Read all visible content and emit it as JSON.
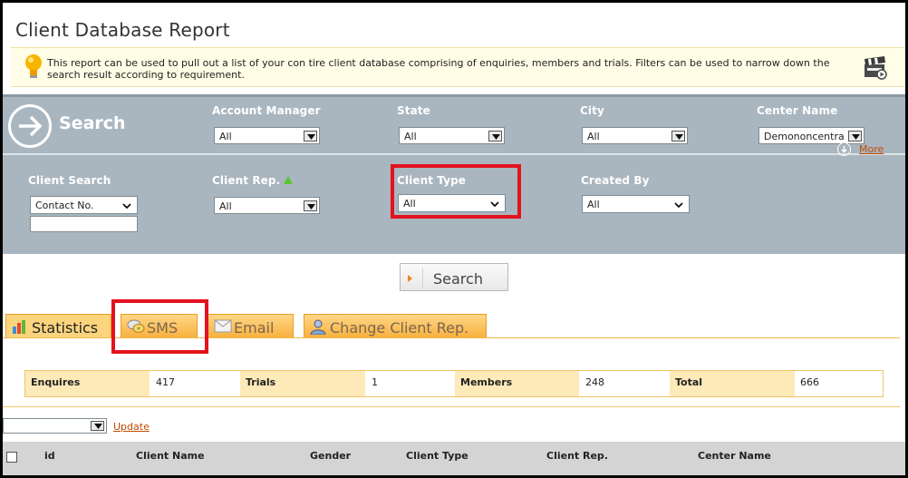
{
  "page": {
    "title": "Client Database Report",
    "info_text": "This report can be used to pull out a list of your con tire client database comprising of enquiries, members and trials. Filters can be used to narrow down the search result according to requirement."
  },
  "search_panel": {
    "heading": "Search",
    "filters": {
      "account_manager": {
        "label": "Account Manager",
        "value": "All"
      },
      "state": {
        "label": "State",
        "value": "All"
      },
      "city": {
        "label": "City",
        "value": "All"
      },
      "center_name": {
        "label": "Center Name",
        "value": "Demononcentra"
      },
      "client_search": {
        "label": "Client Search",
        "value": "Contact No."
      },
      "client_rep": {
        "label": "Client Rep.",
        "value": "All"
      },
      "client_type": {
        "label": "Client Type",
        "value": "All"
      },
      "created_by": {
        "label": "Created By",
        "value": "All"
      }
    },
    "more_label": "More",
    "search_button": "Search"
  },
  "tabs": [
    {
      "label": "Statistics",
      "icon": "bar-chart-icon"
    },
    {
      "label": "SMS",
      "icon": "chat-bubble-icon"
    },
    {
      "label": "Email",
      "icon": "envelope-icon"
    },
    {
      "label": "Change Client Rep.",
      "icon": "user-icon"
    }
  ],
  "stats": [
    {
      "label": "Enquires",
      "value": "417"
    },
    {
      "label": "Trials",
      "value": "1"
    },
    {
      "label": "Members",
      "value": "248"
    },
    {
      "label": "Total",
      "value": "666"
    }
  ],
  "update_label": "Update",
  "table": {
    "columns": [
      "id",
      "Client Name",
      "Gender",
      "Client Type",
      "Client Rep.",
      "Center Name"
    ]
  },
  "colors": {
    "panel": "#a9b6c0",
    "tab": "#f8b13f",
    "highlight": "#e3121f",
    "link": "#c24a00"
  }
}
